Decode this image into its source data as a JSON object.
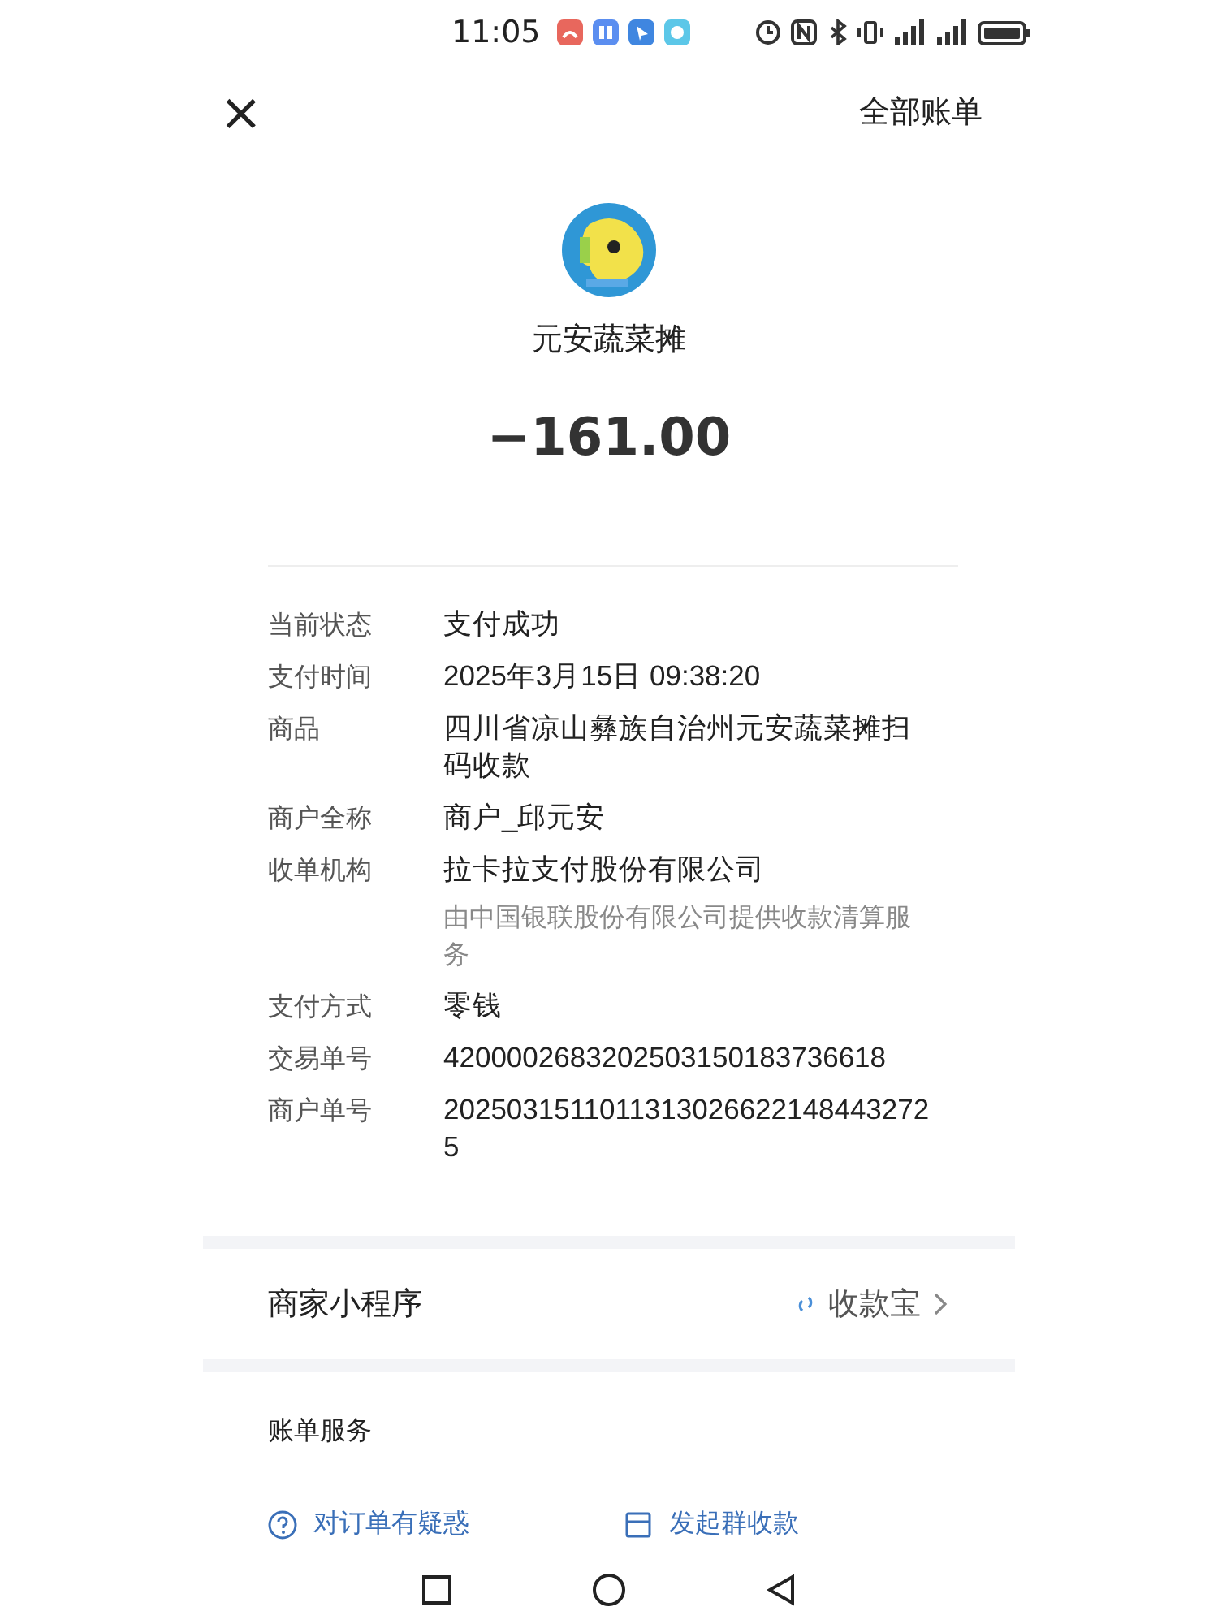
{
  "status_bar": {
    "time": "11:05"
  },
  "header": {
    "close": "×",
    "all_bills": "全部账单"
  },
  "merchant": {
    "name": "元安蔬菜摊",
    "amount": "−161.00"
  },
  "details": [
    {
      "label": "当前状态",
      "value": "支付成功"
    },
    {
      "label": "支付时间",
      "value": "2025年3月15日 09:38:20"
    },
    {
      "label": "商品",
      "value": "四川省凉山彝族自治州元安蔬菜摊扫码收款"
    },
    {
      "label": "商户全称",
      "value": "商户_邱元安"
    },
    {
      "label": "收单机构",
      "value": "拉卡拉支付股份有限公司",
      "note": "由中国银联股份有限公司提供收款清算服务"
    },
    {
      "label": "支付方式",
      "value": "零钱"
    },
    {
      "label": "交易单号",
      "value": "4200002683202503150183736618"
    },
    {
      "label": "商户单号",
      "value": "20250315110113130266221484432725"
    }
  ],
  "mini_program": {
    "title": "商家小程序",
    "link": "收款宝"
  },
  "bill_service": {
    "title": "账单服务",
    "actions": [
      {
        "kind": "question",
        "label": "对订单有疑惑"
      },
      {
        "kind": "group",
        "label": "发起群收款"
      }
    ]
  }
}
